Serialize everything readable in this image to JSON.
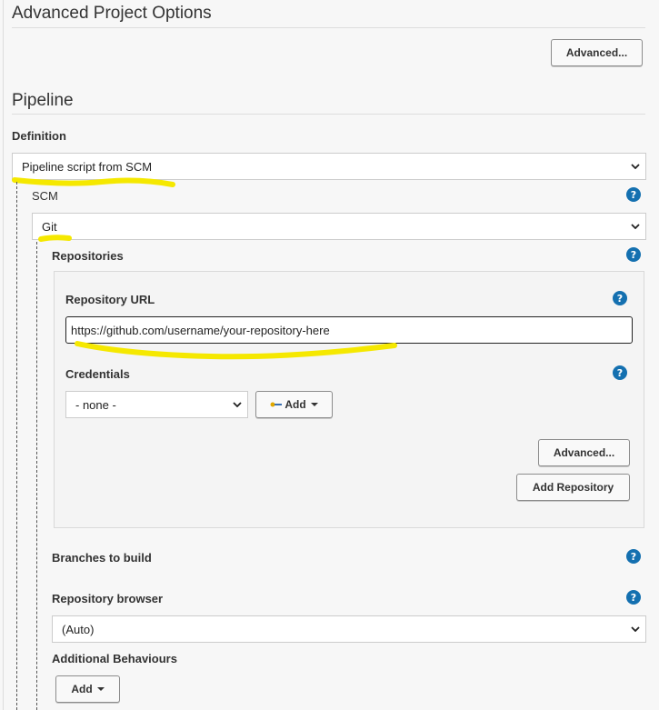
{
  "advanced_project_options": {
    "title": "Advanced Project Options",
    "advanced_button": "Advanced..."
  },
  "pipeline": {
    "title": "Pipeline",
    "definition_label": "Definition",
    "definition_value": "Pipeline script from SCM",
    "scm_label": "SCM",
    "scm_value": "Git",
    "repositories_label": "Repositories",
    "repository_url_label": "Repository URL",
    "repository_url_value": "https://github.com/username/your-repository-here",
    "credentials_label": "Credentials",
    "credentials_value": "- none -",
    "credentials_add_button": "Add",
    "repo_advanced_button": "Advanced...",
    "add_repository_button": "Add Repository",
    "branches_label": "Branches to build",
    "repository_browser_label": "Repository browser",
    "repository_browser_value": "(Auto)",
    "additional_behaviours_label": "Additional Behaviours",
    "additional_add_button": "Add"
  },
  "icons": {
    "help": "help-icon",
    "dropdown": "chevron-down-icon",
    "key": "key-icon"
  },
  "colors": {
    "highlight": "#f5e800",
    "help_icon": "#1470b0"
  }
}
